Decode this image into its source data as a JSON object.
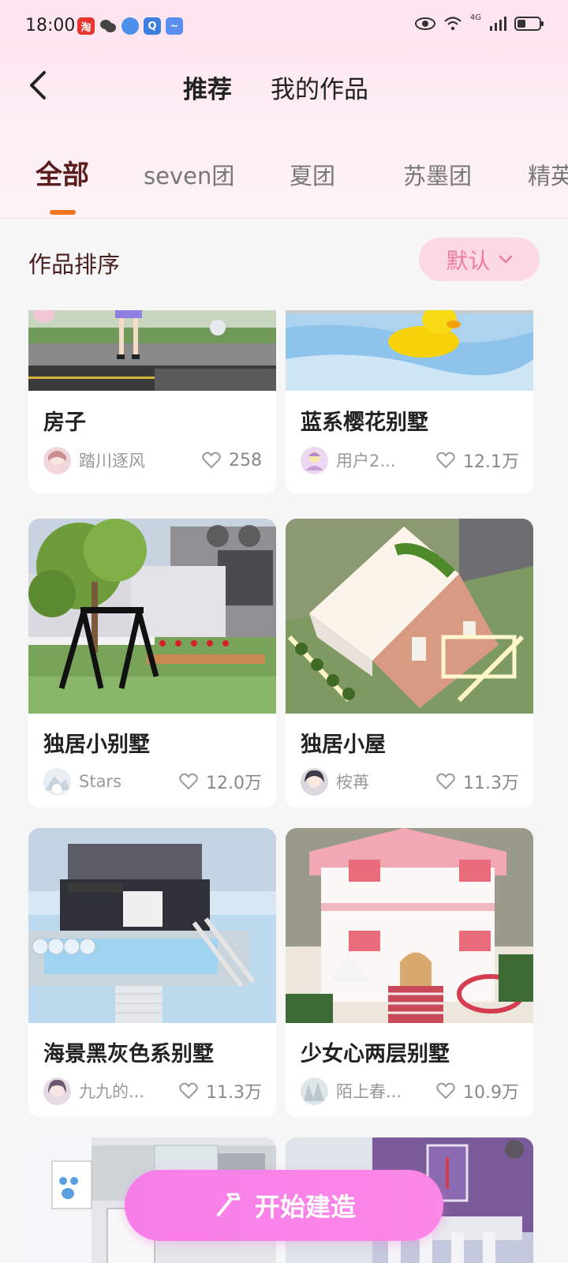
{
  "status": {
    "time": "18:00",
    "network": "4G",
    "app_icons": [
      "taobao-icon",
      "wechat-icon",
      "browser-icon",
      "app-icon",
      "cloud-icon"
    ]
  },
  "header": {
    "tabs": [
      {
        "label": "推荐",
        "active": true
      },
      {
        "label": "我的作品",
        "active": false
      }
    ]
  },
  "categories": [
    {
      "label": "全部",
      "active": true
    },
    {
      "label": "seven团",
      "active": false
    },
    {
      "label": "夏团",
      "active": false
    },
    {
      "label": "苏墨团",
      "active": false
    },
    {
      "label": "精英",
      "active": false
    }
  ],
  "sort": {
    "label": "作品排序",
    "value": "默认"
  },
  "cards": [
    {
      "title": "房子",
      "author": "踏川逐风",
      "likes": "258"
    },
    {
      "title": "蓝系樱花别墅",
      "author": "用户2...",
      "likes": "12.1万"
    },
    {
      "title": "独居小别墅",
      "author": "Stars",
      "likes": "12.0万"
    },
    {
      "title": "独居小屋",
      "author": "桉苒",
      "likes": "11.3万"
    },
    {
      "title": "海景黑灰色系别墅",
      "author": "九九的...",
      "likes": "11.3万"
    },
    {
      "title": "少女心两层别墅",
      "author": "陌上春...",
      "likes": "10.9万"
    },
    {
      "title": "",
      "author": "",
      "likes": ""
    },
    {
      "title": "",
      "author": "",
      "likes": ""
    }
  ],
  "fab": {
    "label": "开始建造"
  },
  "colors": {
    "accent": "#f5731c",
    "pink": "#f07b9d",
    "fab": "#f77ee9"
  }
}
